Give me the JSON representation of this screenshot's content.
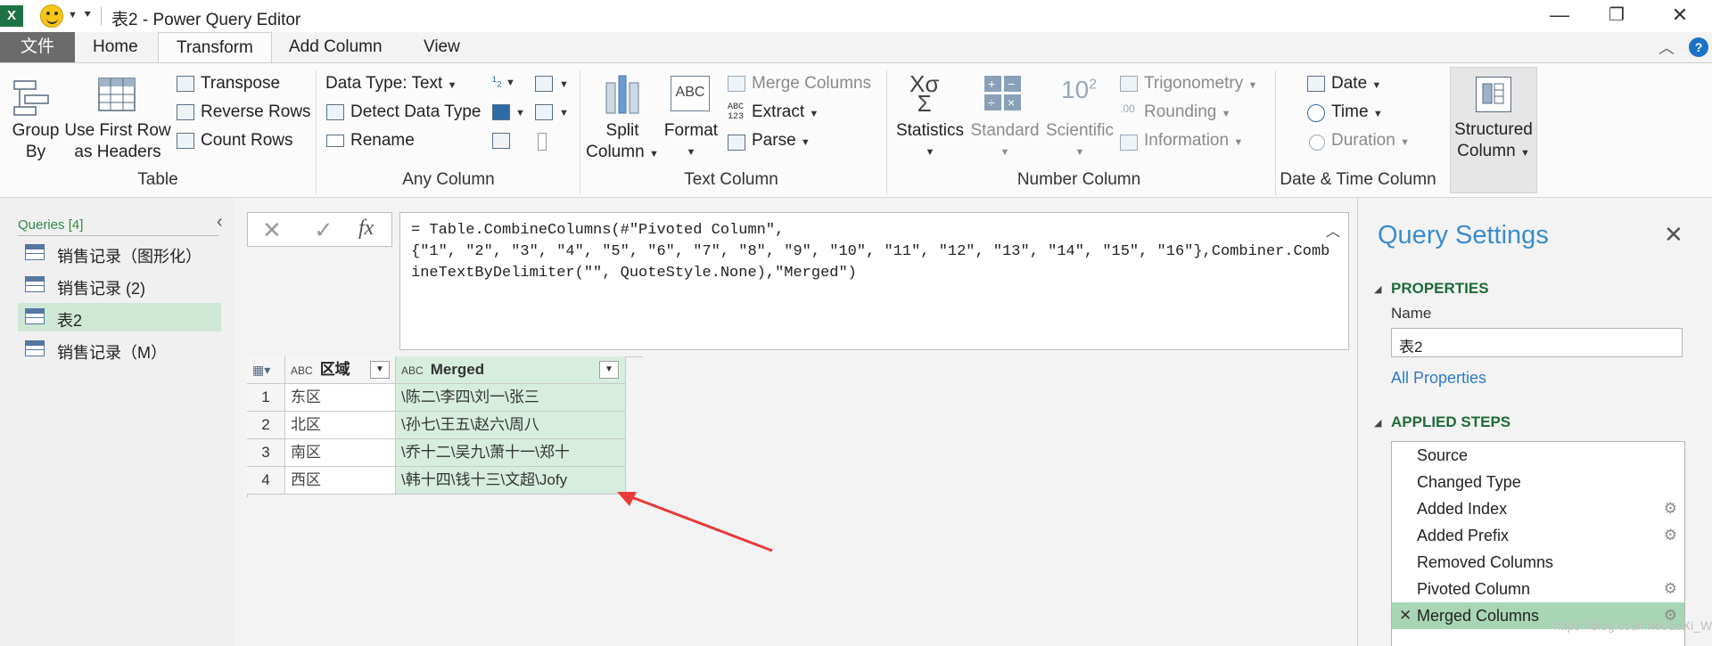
{
  "window": {
    "app_badge": "X",
    "title": "表2 - Power Query Editor",
    "minimize": "—",
    "restore": "❐",
    "close": "✕"
  },
  "tabs": {
    "file": "文件",
    "items": [
      "Home",
      "Transform",
      "Add Column",
      "View"
    ],
    "active": "Transform",
    "help": "?"
  },
  "ribbon": {
    "table_group": {
      "label": "Table",
      "group_by": [
        "Group",
        "By"
      ],
      "first_row": [
        "Use First Row",
        "as Headers"
      ],
      "transpose": "Transpose",
      "reverse_rows": "Reverse Rows",
      "count_rows": "Count Rows"
    },
    "any_column_group": {
      "label": "Any Column",
      "data_type": "Data Type: Text",
      "detect_data_type": "Detect Data Type",
      "rename": "Rename"
    },
    "text_column_group": {
      "label": "Text Column",
      "split_column": [
        "Split",
        "Column"
      ],
      "format": "Format",
      "merge_columns": "Merge Columns",
      "extract": "Extract",
      "parse": "Parse",
      "format_icon_text": "ABC",
      "extract_icon_top": "ABC",
      "extract_icon_bottom": "123"
    },
    "number_column_group": {
      "label": "Number Column",
      "statistics": "Statistics",
      "standard": "Standard",
      "scientific": "Scientific",
      "scientific_icon": "10",
      "scientific_exp": "2",
      "trigonometry": "Trigonometry",
      "rounding": "Rounding",
      "information": "Information"
    },
    "datetime_group": {
      "label": "Date & Time Column",
      "date": "Date",
      "time": "Time",
      "duration": "Duration"
    },
    "structured": [
      "Structured",
      "Column"
    ]
  },
  "queries": {
    "header": "Queries [4]",
    "items": [
      "销售记录（图形化）",
      "销售记录 (2)",
      "表2",
      "销售记录（M）"
    ],
    "selected": "表2"
  },
  "formula": {
    "cancel": "✕",
    "commit": "✓",
    "fx": "fx",
    "text": "= Table.CombineColumns(#\"Pivoted Column\",\n{\"1\", \"2\", \"3\", \"4\", \"5\", \"6\", \"7\", \"8\", \"9\", \"10\", \"11\", \"12\", \"13\", \"14\", \"15\", \"16\"},Combiner.CombineTextByDelimiter(\"\", QuoteStyle.None),\"Merged\")"
  },
  "grid": {
    "type_badge": "ABC",
    "columns": [
      "区域",
      "Merged"
    ],
    "rows": [
      {
        "n": "1",
        "region": "东区",
        "merged": "\\陈二\\李四\\刘一\\张三"
      },
      {
        "n": "2",
        "region": "北区",
        "merged": "\\孙七\\王五\\赵六\\周八"
      },
      {
        "n": "3",
        "region": "南区",
        "merged": "\\乔十二\\吴九\\萧十一\\郑十"
      },
      {
        "n": "4",
        "region": "西区",
        "merged": "\\韩十四\\钱十三\\文超\\Jofy"
      }
    ]
  },
  "settings": {
    "title": "Query Settings",
    "close": "✕",
    "properties": "PROPERTIES",
    "name_label": "Name",
    "name_value": "表2",
    "all_properties": "All Properties",
    "applied_steps": "APPLIED STEPS",
    "steps": [
      "Source",
      "Changed Type",
      "Added Index",
      "Added Prefix",
      "Removed Columns",
      "Pivoted Column",
      "Merged Columns"
    ],
    "selected_step": "Merged Columns",
    "delete_step": "✕",
    "step_settings": "⚙"
  },
  "watermark": "https://blog.csdn.net/LuXi_WeiJun",
  "colors": {
    "accent_green": "#1e6b3a",
    "selected_bg": "#a8d6b5",
    "merged_col_bg": "#d7eedf",
    "title_blue": "#3a8ccd",
    "arrow_red": "#e83a3a"
  }
}
